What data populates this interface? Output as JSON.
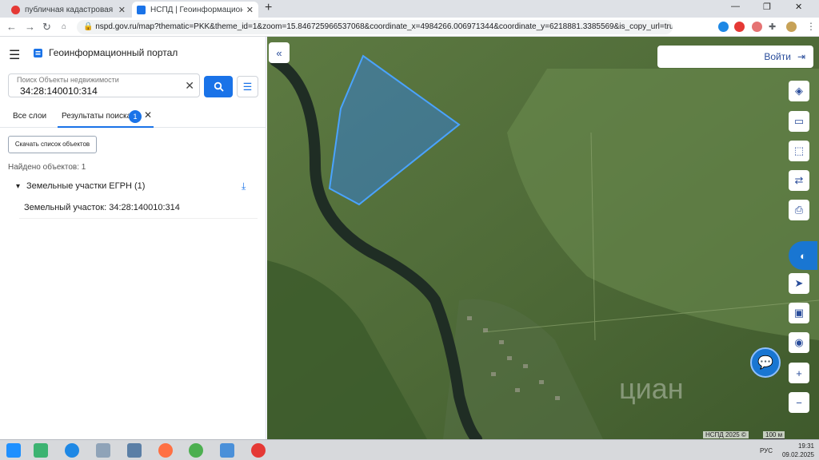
{
  "browser": {
    "tabs": [
      {
        "title": "публичная кадастровая карта —",
        "close": "✕"
      },
      {
        "title": "НСПД | Геоинформационный п",
        "close": "✕"
      }
    ],
    "new_tab": "+",
    "window_controls": {
      "minimize": "—",
      "maximize": "❐",
      "close": "✕"
    },
    "nav": {
      "back": "←",
      "forward": "→",
      "reload": "↻"
    },
    "url": "nspd.gov.ru/map?thematic=PKK&theme_id=1&zoom=15.846725966537068&coordinate_x=4984266.006971344&coordinate_y=6218881.3385569&is_copy_url=true&baseLay..."
  },
  "panel": {
    "title": "Геоинформационный портал",
    "search": {
      "caption": "Поиск Объекты недвижимости",
      "value": "34:28:140010:314",
      "clear": "✕"
    },
    "tabs": {
      "all_layers": "Все слои",
      "results": "Результаты поиска",
      "results_count": "1",
      "close": "✕"
    },
    "download_button": "Скачать список объектов",
    "found": "Найдено объектов: 1",
    "group": {
      "label": "Земельные участки ЕГРН (1)"
    },
    "item": "Земельный участок: 34:28:140010:314"
  },
  "map": {
    "login": "Войти",
    "copyright": "НСПД 2025 ©",
    "scale": "100 м",
    "watermark": "циан",
    "plus": "+",
    "minus": "−"
  },
  "taskbar": {
    "lang": "РУС",
    "time": "19:31",
    "date": "09.02.2025"
  },
  "colors": {
    "accent": "#1a73e8",
    "parcel_fill": "#2f80ed",
    "parcel_stroke": "#4aa3ff",
    "river": "#1f2d24"
  }
}
